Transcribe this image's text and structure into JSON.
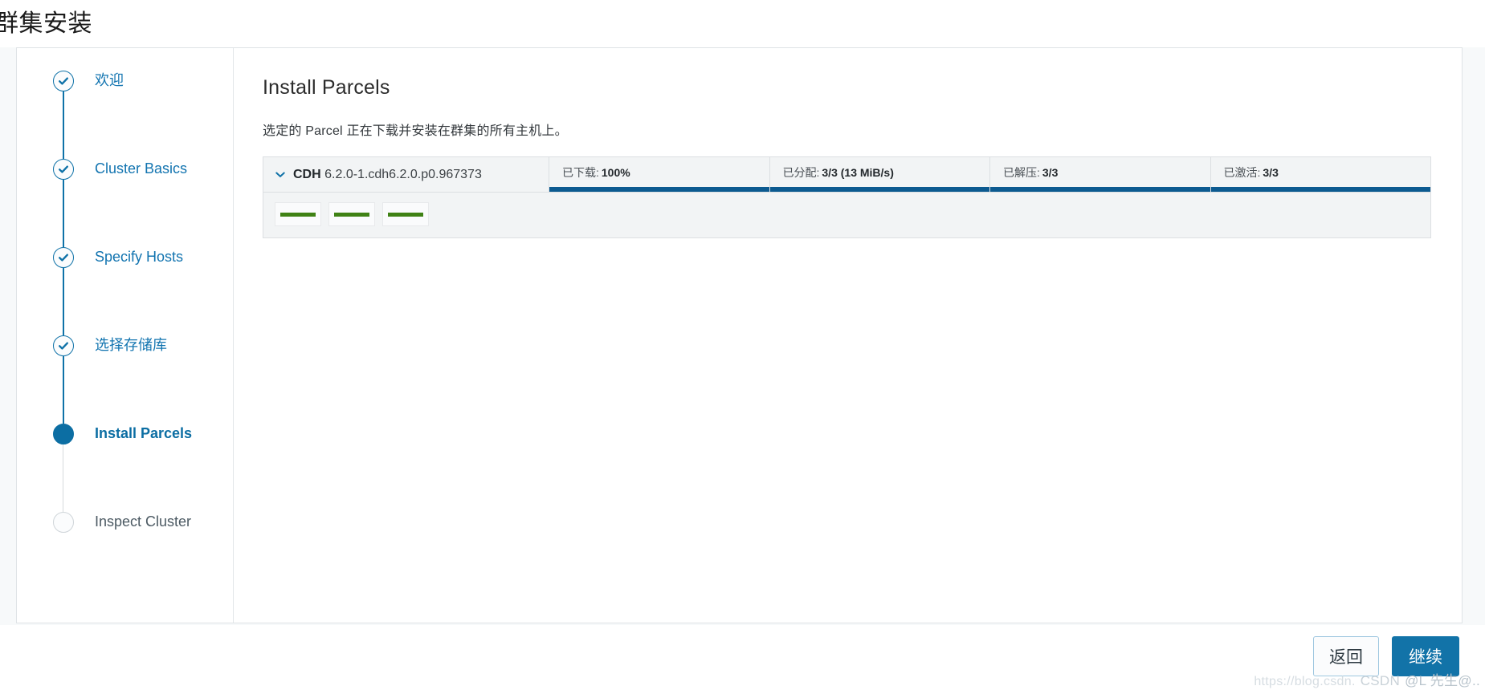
{
  "page": {
    "title": "群集安装"
  },
  "steps": [
    {
      "label": "欢迎",
      "state": "done",
      "icon": "check-circle-icon"
    },
    {
      "label": "Cluster Basics",
      "state": "done",
      "icon": "check-circle-icon"
    },
    {
      "label": "Specify Hosts",
      "state": "done",
      "icon": "check-circle-icon"
    },
    {
      "label": "选择存储库",
      "state": "done",
      "icon": "check-circle-icon"
    },
    {
      "label": "Install Parcels",
      "state": "active",
      "icon": "filled-circle-icon"
    },
    {
      "label": "Inspect Cluster",
      "state": "pending",
      "icon": "empty-circle-icon"
    }
  ],
  "main": {
    "title": "Install Parcels",
    "description": "选定的 Parcel 正在下载并安装在群集的所有主机上。",
    "parcel": {
      "expand_icon": "chevron-down-icon",
      "name": "CDH",
      "version": "6.2.0-1.cdh6.2.0.p0.967373",
      "progress": [
        {
          "label": "已下载:",
          "value": "100%",
          "percent": 100
        },
        {
          "label": "已分配:",
          "value": "3/3 (13 MiB/s)",
          "percent": 100
        },
        {
          "label": "已解压:",
          "value": "3/3",
          "percent": 100
        },
        {
          "label": "已激活:",
          "value": "3/3",
          "percent": 100
        }
      ],
      "hosts": [
        {
          "percent": 100
        },
        {
          "percent": 100
        },
        {
          "percent": 100
        }
      ]
    }
  },
  "footer": {
    "back_label": "返回",
    "continue_label": "继续"
  },
  "watermark": {
    "url": "https://blog.csdn.",
    "brand": "CSDN",
    "user": "@L 先生@.."
  },
  "colors": {
    "accent_blue": "#1273a8",
    "progress_blue": "#0c5a90",
    "host_green": "#3f8215",
    "panel_bg": "#f2f4f5",
    "done_blue": "#1274b0"
  }
}
